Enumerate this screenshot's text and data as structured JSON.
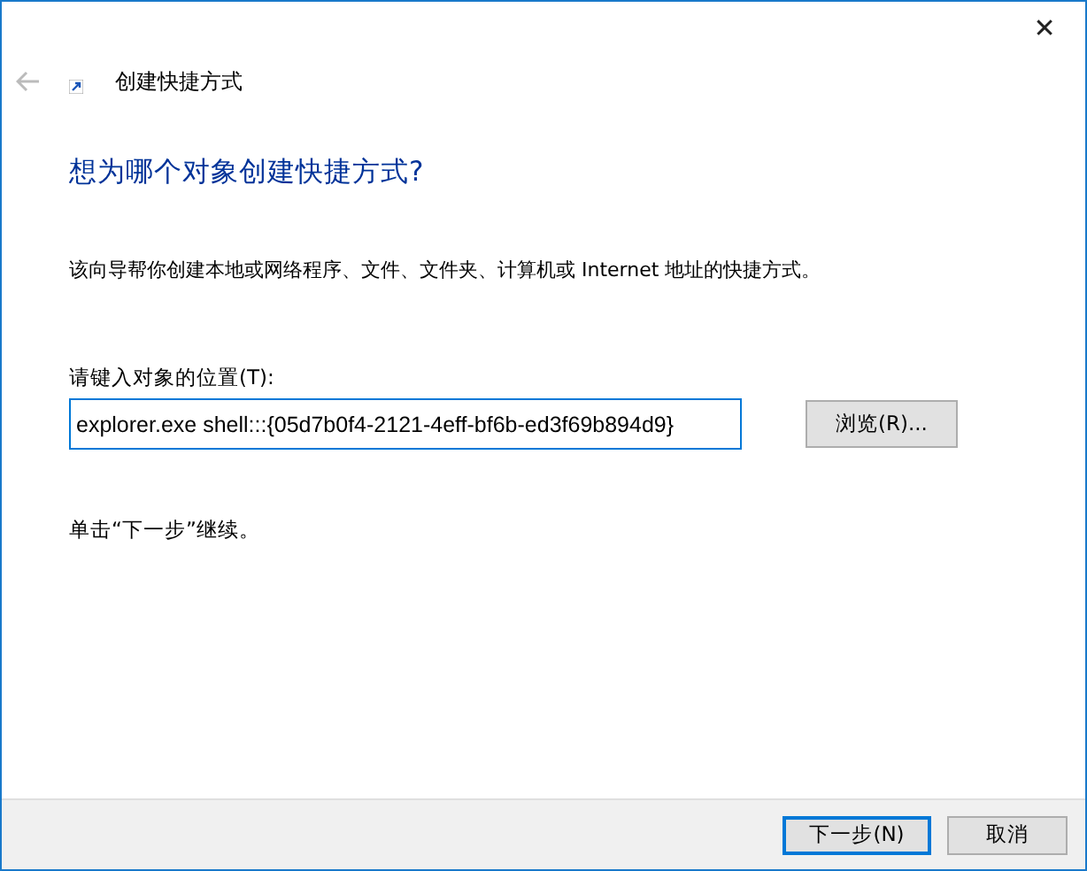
{
  "window": {
    "title": "创建快捷方式",
    "close": "✕"
  },
  "heading": "想为哪个对象创建快捷方式?",
  "description": "该向导帮你创建本地或网络程序、文件、文件夹、计算机或 Internet 地址的快捷方式。",
  "location": {
    "label": "请键入对象的位置(T):",
    "value": "explorer.exe shell:::{05d7b0f4-2121-4eff-bf6b-ed3f69b894d9}",
    "browse": "浏览(R)..."
  },
  "hint": "单击“下一步”继续。",
  "buttons": [
    {
      "label": "下一步(N)",
      "selected": true
    },
    {
      "label": "取消",
      "selected": false
    }
  ]
}
